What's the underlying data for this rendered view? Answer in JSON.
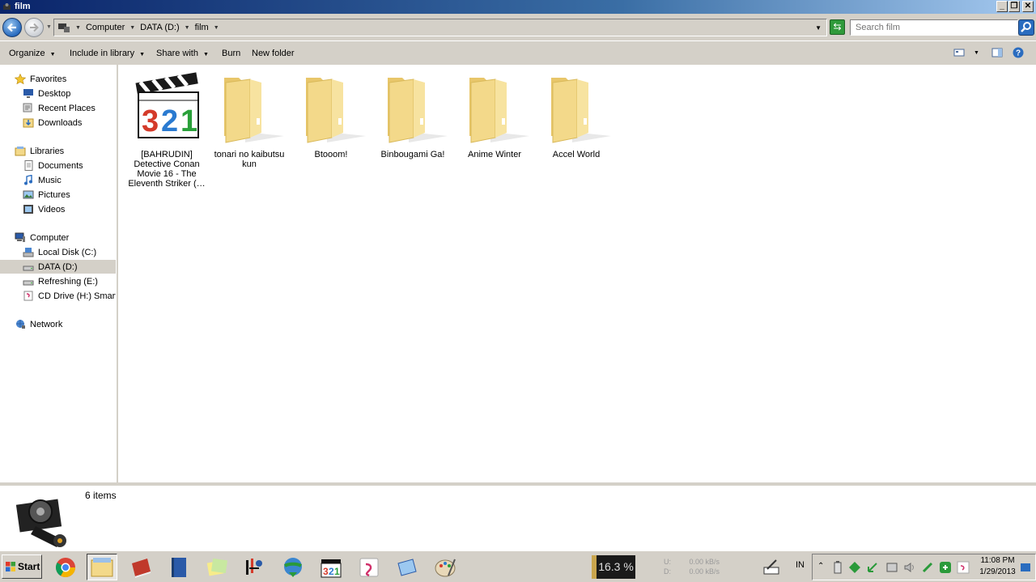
{
  "window": {
    "title": "film"
  },
  "address": {
    "crumbs": [
      "Computer",
      "DATA (D:)",
      "film"
    ],
    "search_placeholder": "Search film"
  },
  "toolbar": {
    "organize": "Organize",
    "include_in_library": "Include in library",
    "share_with": "Share with",
    "burn": "Burn",
    "new_folder": "New folder"
  },
  "nav": {
    "favorites": "Favorites",
    "desktop": "Desktop",
    "recent_places": "Recent Places",
    "downloads": "Downloads",
    "libraries": "Libraries",
    "documents": "Documents",
    "music": "Music",
    "pictures": "Pictures",
    "videos": "Videos",
    "computer": "Computer",
    "local_disk": "Local Disk (C:)",
    "data_disk": "DATA (D:)",
    "refreshing": "Refreshing (E:)",
    "cd_drive": "CD Drive (H:) Smartfr",
    "network": "Network"
  },
  "files": [
    {
      "name": "[BAHRUDIN] Detective Conan Movie 16 - The Eleventh Striker (…",
      "type": "video",
      "icon": "mpc-hc-321-icon"
    },
    {
      "name": "tonari no kaibutsu kun",
      "type": "folder",
      "icon": "folder-icon"
    },
    {
      "name": "Btooom!",
      "type": "folder",
      "icon": "folder-icon"
    },
    {
      "name": "Binbougami Ga!",
      "type": "folder",
      "icon": "folder-icon"
    },
    {
      "name": "Anime Winter",
      "type": "folder",
      "icon": "folder-icon"
    },
    {
      "name": "Accel World",
      "type": "folder",
      "icon": "folder-icon"
    }
  ],
  "details": {
    "item_count": "6 items"
  },
  "taskbar": {
    "start": "Start",
    "cpu": "16.3 %",
    "net_up_label": "U:",
    "net_down_label": "D:",
    "net_up": "0.00 kB/s",
    "net_down": "0.00 kB/s",
    "lang": "IN",
    "time": "11:08 PM",
    "date": "1/29/2013"
  },
  "colors": {
    "chrome": "#d4d0c8",
    "folder_yellow": "#f3d98a",
    "title_blue": "#0a246a"
  }
}
